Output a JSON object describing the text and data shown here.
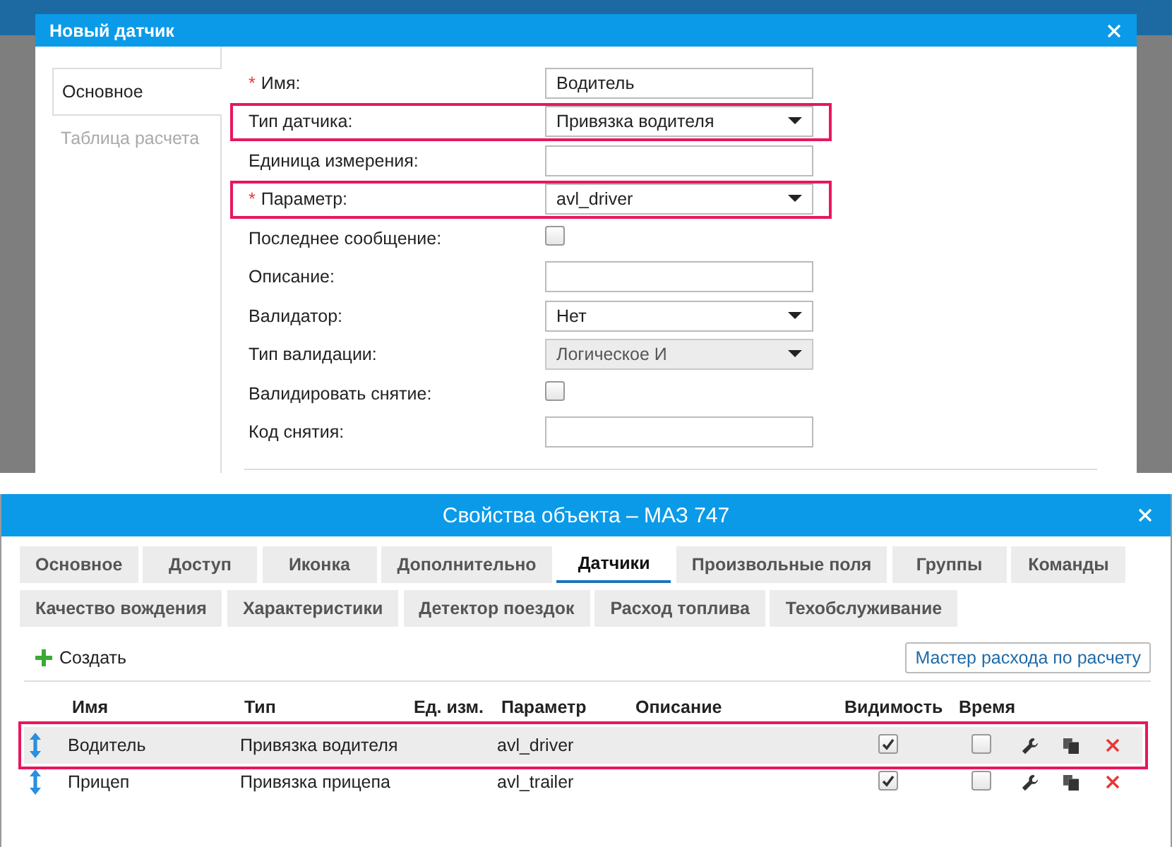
{
  "sensor_dialog": {
    "title": "Новый датчик",
    "tabs": [
      {
        "label": "Основное",
        "selected": true
      },
      {
        "label": "Таблица расчета",
        "selected": false
      }
    ],
    "fields": [
      {
        "label": "Имя:",
        "required_mark": "*",
        "kind": "text",
        "value": "Водитель",
        "highlighted": false,
        "disabled": false
      },
      {
        "label": "Тип датчика:",
        "kind": "select",
        "value": "Привязка водителя",
        "highlighted": true,
        "disabled": false
      },
      {
        "label": "Единица измерения:",
        "kind": "text",
        "highlighted": false,
        "disabled": false
      },
      {
        "label": "Параметр:",
        "required_mark": "*",
        "kind": "select",
        "value": "avl_driver",
        "highlighted": true,
        "disabled": false
      },
      {
        "label": "Последнее сообщение:",
        "kind": "checkbox",
        "checked": false,
        "highlighted": false,
        "disabled": false
      },
      {
        "label": "Описание:",
        "kind": "text",
        "highlighted": false,
        "disabled": false
      },
      {
        "label": "Валидатор:",
        "kind": "select",
        "value": "Нет",
        "highlighted": false,
        "disabled": false
      },
      {
        "label": "Тип валидации:",
        "kind": "select",
        "value": "Логическое И",
        "highlighted": false,
        "disabled": true
      },
      {
        "label": "Валидировать снятие:",
        "kind": "checkbox",
        "checked": false,
        "highlighted": false,
        "disabled": false
      },
      {
        "label": "Код снятия:",
        "kind": "text",
        "highlighted": false,
        "disabled": false
      }
    ]
  },
  "object_dialog": {
    "title": "Свойства объекта – МАЗ 747",
    "tabs": [
      {
        "label": "Основное",
        "selected": false
      },
      {
        "label": "Доступ",
        "selected": false
      },
      {
        "label": "Иконка",
        "selected": false
      },
      {
        "label": "Дополнительно",
        "selected": false
      },
      {
        "label": "Датчики",
        "selected": true
      },
      {
        "label": "Произвольные поля",
        "selected": false
      },
      {
        "label": "Группы",
        "selected": false
      },
      {
        "label": "Команды",
        "selected": false
      },
      {
        "label": "Качество вождения",
        "selected": false
      },
      {
        "label": "Характеристики",
        "selected": false
      },
      {
        "label": "Детектор поездок",
        "selected": false
      },
      {
        "label": "Расход топлива",
        "selected": false
      },
      {
        "label": "Техобслуживание",
        "selected": false
      }
    ],
    "create_button": "Создать",
    "wizard_button": "Мастер расхода по расчету",
    "table": {
      "columns": [
        "Имя",
        "Тип",
        "Ед. изм.",
        "Параметр",
        "Описание",
        "Видимость",
        "Время"
      ],
      "rows": [
        {
          "name": "Водитель",
          "type": "Привязка водителя",
          "parameter": "avl_driver",
          "visible": true,
          "time": false,
          "selected": true,
          "highlighted": true
        },
        {
          "name": "Прицеп",
          "type": "Привязка прицепа",
          "parameter": "avl_trailer",
          "visible": true,
          "time": false,
          "selected": false,
          "highlighted": false
        }
      ]
    }
  }
}
